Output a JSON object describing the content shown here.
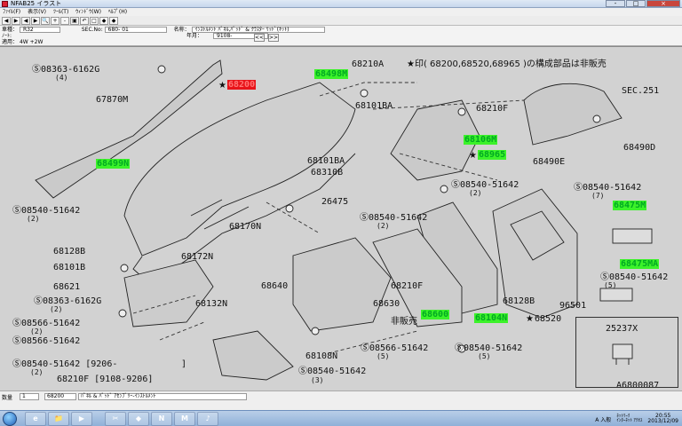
{
  "window": {
    "title": "NFAB25 イラスト",
    "controls": [
      "-",
      "□",
      "×"
    ]
  },
  "menu": [
    "ﾌｧｲﾙ(F)",
    "表示(V)",
    "ﾂｰﾙ(T)",
    "ｳｨﾝﾄﾞｳ(W)",
    "ﾍﾙﾌﾟ(H)"
  ],
  "toolbar": {
    "buttons": [
      "◀",
      "▶",
      "◀",
      "▶",
      "🔍",
      "+",
      "-",
      "▣",
      "↶",
      "□",
      "◆",
      "◆"
    ]
  },
  "info": {
    "row1": {
      "car_label": "車種：",
      "car_value": "R32",
      "sec_label": "SEC.No:",
      "sec_value": "680- 01",
      "name_label": "名称：",
      "name_value": "ｲﾝｽﾄﾙﾒﾝﾄ ﾊﾟﾈﾙ,ﾊﾟｯﾄﾞ & ｸﾗｽﾀｰ ﾘｯﾄﾞ(ｷｯﾄ)"
    },
    "row2": {
      "note_label": "ﾉｰﾄ:",
      "year_label": "年月：",
      "year_value": "9108-"
    },
    "row3": {
      "apply_label": "適用：",
      "apply_value": "4W +2W"
    },
    "prev": "<<",
    "next": ">>"
  },
  "diagram": {
    "labels": [
      {
        "text": "Ⓢ08363-6162G",
        "id": "l1"
      },
      {
        "text": "67870M",
        "id": "l2"
      },
      {
        "text": "68210A",
        "id": "l3"
      },
      {
        "text": "68101BA",
        "id": "l4"
      },
      {
        "text": "68210F",
        "id": "l5"
      },
      {
        "text": "SEC.251",
        "id": "l6"
      },
      {
        "text": "68490D",
        "id": "l7"
      },
      {
        "text": "68490E",
        "id": "l8"
      },
      {
        "text": "68101BA",
        "id": "l9"
      },
      {
        "text": "68310B",
        "id": "l10"
      },
      {
        "text": "Ⓢ08540-51642",
        "id": "l11"
      },
      {
        "text": "Ⓢ08540-51642",
        "id": "l12"
      },
      {
        "text": "Ⓢ08540-51642",
        "id": "l13"
      },
      {
        "text": "26475",
        "id": "l14"
      },
      {
        "text": "Ⓢ08540-51642",
        "id": "l15"
      },
      {
        "text": "68170N",
        "id": "l16"
      },
      {
        "text": "68128B",
        "id": "l17"
      },
      {
        "text": "68101B",
        "id": "l18"
      },
      {
        "text": "68172N",
        "id": "l19"
      },
      {
        "text": "68621",
        "id": "l20"
      },
      {
        "text": "68640",
        "id": "l21"
      },
      {
        "text": "68210F",
        "id": "l22"
      },
      {
        "text": "Ⓢ08363-6162G",
        "id": "l23"
      },
      {
        "text": "68132N",
        "id": "l24"
      },
      {
        "text": "68630",
        "id": "l25"
      },
      {
        "text": "68128B",
        "id": "l26"
      },
      {
        "text": "96501",
        "id": "l27"
      },
      {
        "text": "Ⓢ08540-51642",
        "id": "l28"
      },
      {
        "text": "Ⓢ08566-51642",
        "id": "l29"
      },
      {
        "text": "Ⓢ08566-51642",
        "id": "l30"
      },
      {
        "text": "Ⓢ08566-51642",
        "id": "l31"
      },
      {
        "text": "Ⓢ08540-51642",
        "id": "l32"
      },
      {
        "text": "Ⓢ08540-51642 [9206-",
        "id": "l33"
      },
      {
        "text": "]",
        "id": "l33b"
      },
      {
        "text": "68108N",
        "id": "l34"
      },
      {
        "text": "68210F [9108-9206]",
        "id": "l35"
      },
      {
        "text": "Ⓢ08540-51642",
        "id": "l36"
      },
      {
        "text": "25237X",
        "id": "l37"
      },
      {
        "text": "A6800087",
        "id": "l38"
      }
    ],
    "quantities": {
      "q1": "(4)",
      "q2": "(2)",
      "q3": "(5)",
      "q4": "(7)",
      "q5": "(2)",
      "q6": "(2)",
      "q7": "(2)",
      "q8": "(2)",
      "q9": "(5)",
      "q10": "(2)",
      "q11": "(3)",
      "q12": "(5)"
    },
    "highlights": {
      "h_selected": "68200",
      "h1": "68498M",
      "h2": "68499N",
      "h3": "68106M",
      "h4": "68965",
      "h5": "68475M",
      "h6": "68475MA",
      "h7": "68600",
      "h8": "68104N",
      "h9": "68520"
    },
    "stars": {
      "s1": "★",
      "s2": "★",
      "s3": "★"
    },
    "notes": {
      "top_note": "★印( 68200,68520,68965 )の構成部品は非販売",
      "not_for_sale": "非販売"
    }
  },
  "status": {
    "qty_label": "数量",
    "qty_value": "1",
    "part_no": "68200",
    "part_desc": "ﾊﾟﾈﾙ & ﾊﾟｯﾄﾞ ｱｾﾝﾌﾞﾘｰ-ｲﾝｽﾄﾙﾒﾝﾄ"
  },
  "taskbar": {
    "apps": [
      "e",
      "📁",
      "▶",
      "✂",
      "◆",
      "N",
      "M",
      "♪"
    ],
    "tray_text": "A 入般",
    "tray_net": "ﾈｯﾄﾜｰｸ\nｲﾝﾀｰﾈｯﾄ ｱｸｾｽ",
    "clock_time": "20:55",
    "clock_date": "2013/12/09"
  }
}
